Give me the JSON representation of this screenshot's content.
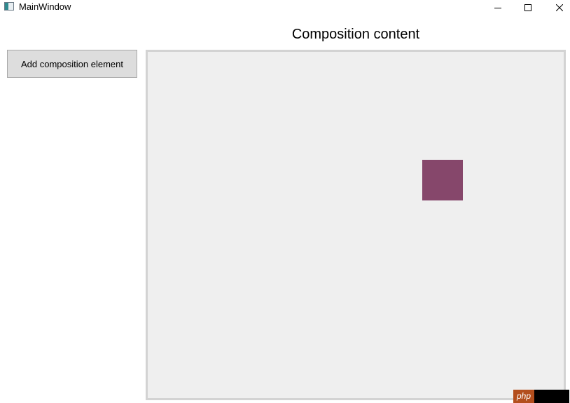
{
  "window": {
    "title": "MainWindow",
    "icon": "app-window-icon",
    "controls": {
      "minimize_icon": "minimize-icon",
      "maximize_icon": "maximize-icon",
      "close_icon": "close-icon"
    }
  },
  "main": {
    "header": "Composition content",
    "add_button_label": "Add composition element",
    "composition_element_color": "#86476b",
    "composition_background": "#efefef"
  },
  "watermark": {
    "text": "php"
  }
}
